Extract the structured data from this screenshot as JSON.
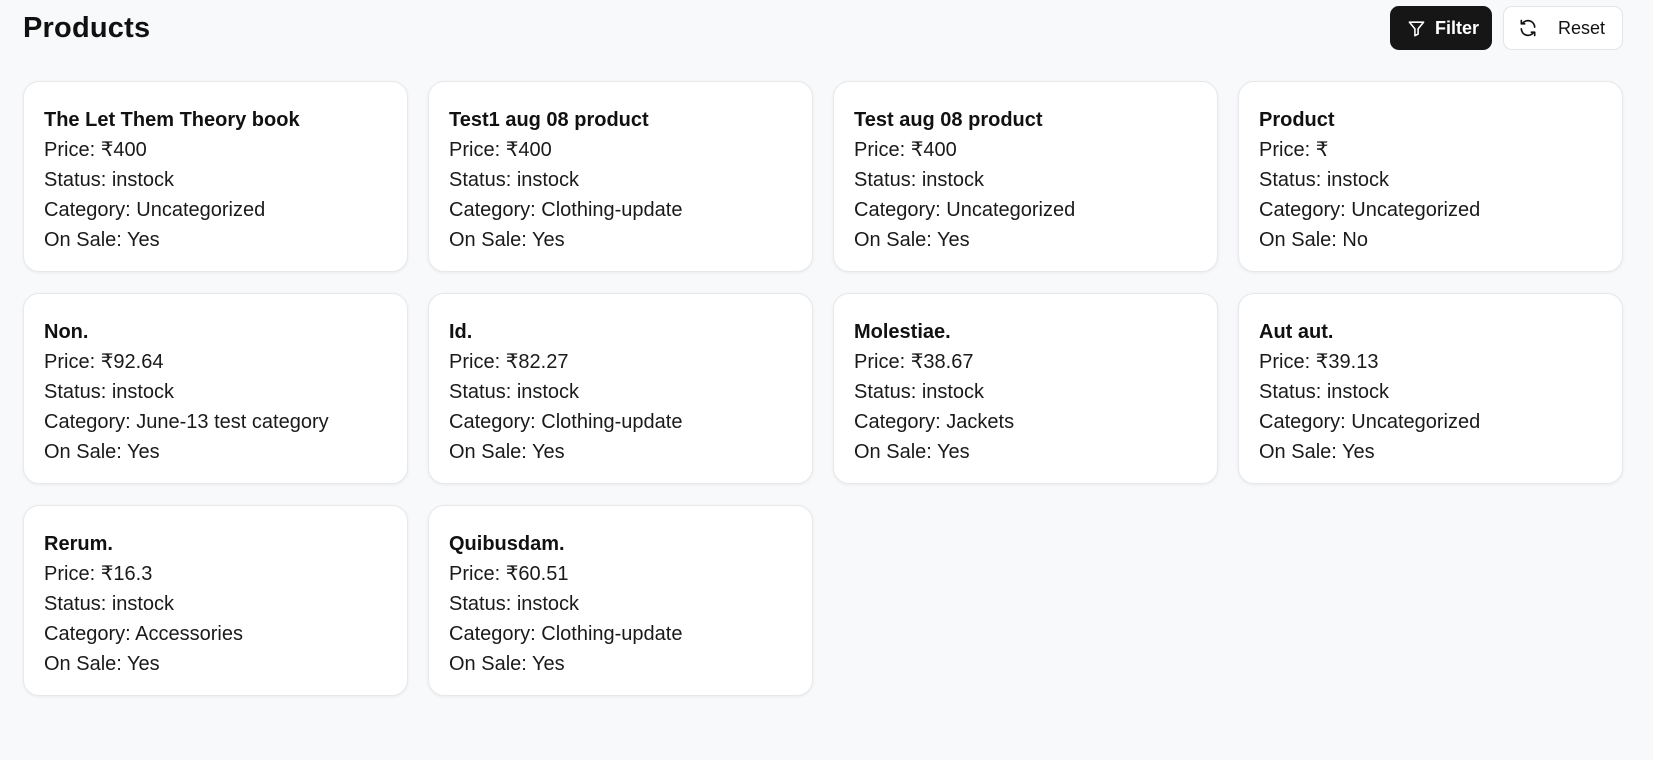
{
  "page_title": "Products",
  "toolbar": {
    "filter_label": "Filter",
    "reset_label": "Reset"
  },
  "labels": {
    "price": "Price: ",
    "status": "Status: ",
    "category": "Category: ",
    "on_sale": "On Sale: "
  },
  "currency": "₹",
  "products": [
    {
      "name": "The Let Them Theory book",
      "price": "400",
      "status": "instock",
      "category": "Uncategorized",
      "on_sale": "Yes"
    },
    {
      "name": "Test1 aug 08 product",
      "price": "400",
      "status": "instock",
      "category": "Clothing-update",
      "on_sale": "Yes"
    },
    {
      "name": "Test aug 08 product",
      "price": "400",
      "status": "instock",
      "category": "Uncategorized",
      "on_sale": "Yes"
    },
    {
      "name": "Product",
      "price": "",
      "status": "instock",
      "category": "Uncategorized",
      "on_sale": "No"
    },
    {
      "name": "Non.",
      "price": "92.64",
      "status": "instock",
      "category": "June-13 test category",
      "on_sale": "Yes"
    },
    {
      "name": "Id.",
      "price": "82.27",
      "status": "instock",
      "category": "Clothing-update",
      "on_sale": "Yes"
    },
    {
      "name": "Molestiae.",
      "price": "38.67",
      "status": "instock",
      "category": "Jackets",
      "on_sale": "Yes"
    },
    {
      "name": "Aut aut.",
      "price": "39.13",
      "status": "instock",
      "category": "Uncategorized",
      "on_sale": "Yes"
    },
    {
      "name": "Rerum.",
      "price": "16.3",
      "status": "instock",
      "category": "Accessories",
      "on_sale": "Yes"
    },
    {
      "name": "Quibusdam.",
      "price": "60.51",
      "status": "instock",
      "category": "Clothing-update",
      "on_sale": "Yes"
    }
  ]
}
